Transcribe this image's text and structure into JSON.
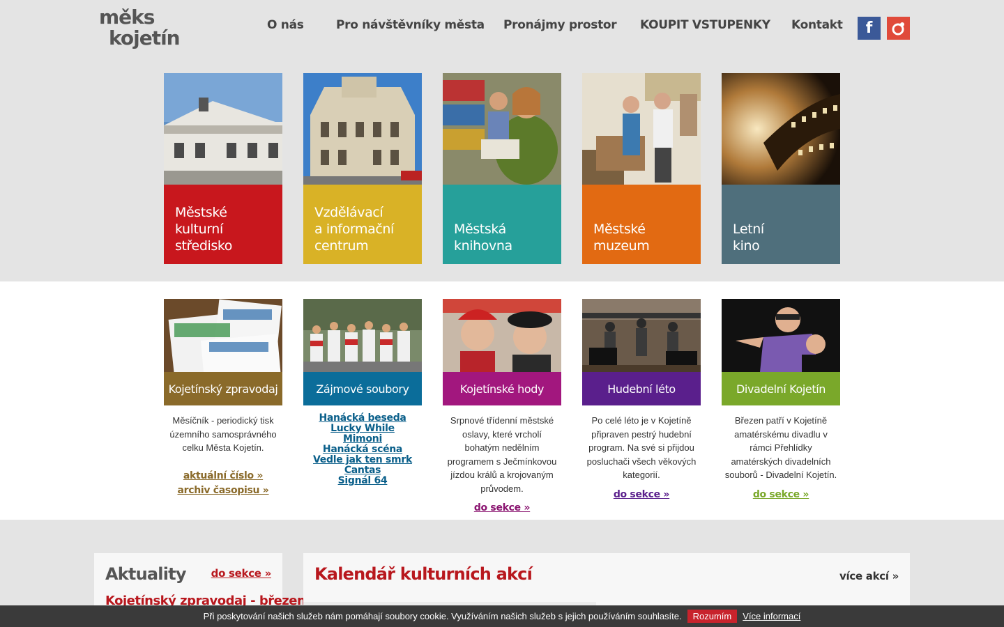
{
  "brand": {
    "logo_line1": "měks",
    "logo_line2": "kojetín"
  },
  "nav": [
    {
      "label": "O nás"
    },
    {
      "label": "Pro návštěvníky města"
    },
    {
      "label": "Pronájmy prostor"
    },
    {
      "label": "KOUPIT VSTUPENKY"
    },
    {
      "label": "Kontakt"
    }
  ],
  "social": {
    "facebook_glyph": "f",
    "facebook_icon": "facebook-icon",
    "other_icon": "instagram-icon"
  },
  "tiles": [
    {
      "label": "Městské kulturní středisko",
      "lines": [
        "Městské",
        "kulturní",
        "středisko"
      ],
      "color": "#c8171d"
    },
    {
      "label": "Vzdělávací a informační centrum",
      "lines": [
        "Vzdělávací",
        "a informační",
        "centrum"
      ],
      "color": "#d9b226"
    },
    {
      "label": "Městská knihovna",
      "lines": [
        "Městská",
        "knihovna"
      ],
      "color": "#26a09a"
    },
    {
      "label": "Městské muzeum",
      "lines": [
        "Městské",
        "muzeum"
      ],
      "color": "#e26a12"
    },
    {
      "label": "Letní kino",
      "lines": [
        "Letní",
        "kino"
      ],
      "color": "#4f6f7c"
    }
  ],
  "sections": [
    {
      "title": "Kojetínský zpravodaj",
      "color": "#8a6a2a",
      "desc": "Měsíčník - periodický tisk územního samosprávného celku Města Kojetín.",
      "links": [
        "aktuální číslo »",
        "archiv časopisu »"
      ],
      "link_color": "#8a6a2a"
    },
    {
      "title": "Zájmové soubory",
      "color": "#0b6d9a",
      "groups": [
        "Hanácká beseda",
        "Lucky While",
        "Mimoni",
        "Hanácká scéna",
        "Vedle jak ten smrk",
        "Cantas",
        "Signál 64"
      ]
    },
    {
      "title": "Kojetínské hody",
      "color": "#a2177e",
      "desc": "Srpnové třídenní městské oslavy, které vrcholí bohatým nedělním programem s Ječmínkovou jízdou králů a krojovaným průvodem.",
      "links": [
        "do sekce »"
      ],
      "link_color": "#8a1470"
    },
    {
      "title": "Hudební léto",
      "color": "#5a1f8c",
      "desc": "Po celé léto je v Kojetíně připraven pestrý hudební program. Na své si přijdou posluchači všech věkových kategorií.",
      "links": [
        "do sekce »"
      ],
      "link_color": "#5a1f8c"
    },
    {
      "title": "Divadelní Kojetín",
      "color": "#7aa82a",
      "desc": "Březen patří v Kojetíně amatérskému divadlu v rámci Přehlídky amatérských divadelních souborů - Divadelní Kojetín.",
      "links": [
        "do sekce »"
      ],
      "link_color": "#7aa82a"
    }
  ],
  "news": {
    "title": "Aktuality",
    "more": "do sekce »",
    "first_item": "Kojetínský zpravodaj - březen"
  },
  "calendar": {
    "title": "Kalendář kulturních akcí",
    "more": "více akcí »"
  },
  "cookie": {
    "text": "Při poskytování našich služeb nám pomáhají soubory cookie. Využíváním našich služeb s jejich používáním souhlasíte.",
    "accept": "Rozumím",
    "more": "Více informací"
  }
}
